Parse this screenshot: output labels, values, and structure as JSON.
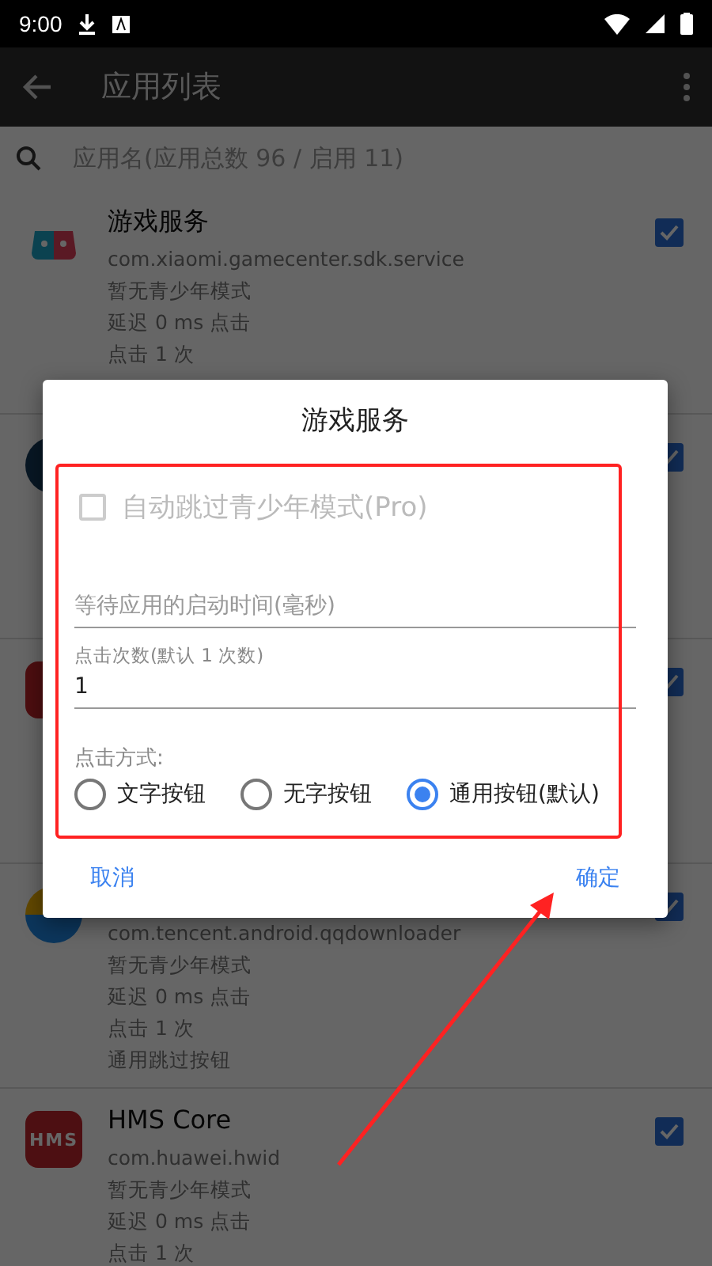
{
  "status_bar": {
    "time": "9:00"
  },
  "app_bar": {
    "title": "应用列表"
  },
  "search": {
    "placeholder": "应用名(应用总数 96 / 启用 11)"
  },
  "apps": [
    {
      "title": "游戏服务",
      "package": "com.xiaomi.gamecenter.sdk.service",
      "lines": [
        "暂无青少年模式",
        "延迟 0 ms 点击",
        "点击 1 次"
      ],
      "checked": true
    },
    {
      "checked": true
    },
    {
      "checked": true
    },
    {
      "package": "com.tencent.android.qqdownloader",
      "lines": [
        "暂无青少年模式",
        "延迟 0 ms 点击",
        "点击 1 次",
        "通用跳过按钮"
      ],
      "checked": true
    },
    {
      "icon_text": "HMS",
      "title": "HMS Core",
      "package": "com.huawei.hwid",
      "lines": [
        "暂无青少年模式",
        "延迟 0 ms 点击",
        "点击 1 次"
      ],
      "checked": true
    }
  ],
  "dialog": {
    "title": "游戏服务",
    "checkbox": {
      "label": "自动跳过青少年模式(Pro)",
      "checked": false,
      "disabled": true
    },
    "wait_field": {
      "placeholder": "等待应用的启动时间(毫秒)"
    },
    "count_field": {
      "label": "点击次数(默认 1 次数)",
      "value": "1"
    },
    "click_mode": {
      "label": "点击方式:",
      "options": [
        {
          "label": "文字按钮",
          "selected": false
        },
        {
          "label": "无字按钮",
          "selected": false
        },
        {
          "label": "通用按钮(默认)",
          "selected": true
        }
      ]
    },
    "buttons": [
      "取消",
      "确定"
    ]
  }
}
